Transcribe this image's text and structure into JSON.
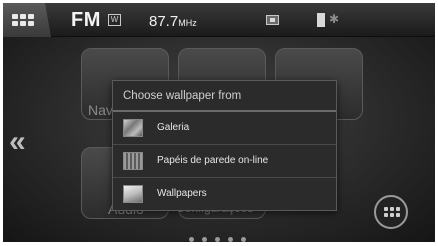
{
  "statusbar": {
    "source_label": "FM",
    "frequency": "87.7",
    "frequency_unit": "MHz",
    "icons": [
      "apps-grid-icon",
      "w-icon",
      "sd-card-icon",
      "usb-icon",
      "bluetooth-icon"
    ]
  },
  "tiles": [
    {
      "label": "Nav",
      "icon": "navigation-icon"
    },
    {
      "label": "",
      "icon": "phone-icon"
    },
    {
      "label": "",
      "icon": "person-icon"
    },
    {
      "label": "Audio",
      "icon": "audio-icon"
    },
    {
      "label": "Configurações",
      "icon": "settings-icon"
    }
  ],
  "dialog": {
    "title": "Choose wallpaper from",
    "options": [
      {
        "label": "Galeria",
        "icon": "gallery-icon"
      },
      {
        "label": "Papéis de parede on-line",
        "icon": "live-wallpaper-icon"
      },
      {
        "label": "Wallpapers",
        "icon": "wallpapers-icon"
      }
    ]
  },
  "nav": {
    "back_glyph": "«",
    "page_count": 5
  },
  "colors": {
    "statusbar_bg": "#1b1b1b",
    "dialog_bg": "#2b2b2b",
    "text": "#e6e6e6"
  }
}
